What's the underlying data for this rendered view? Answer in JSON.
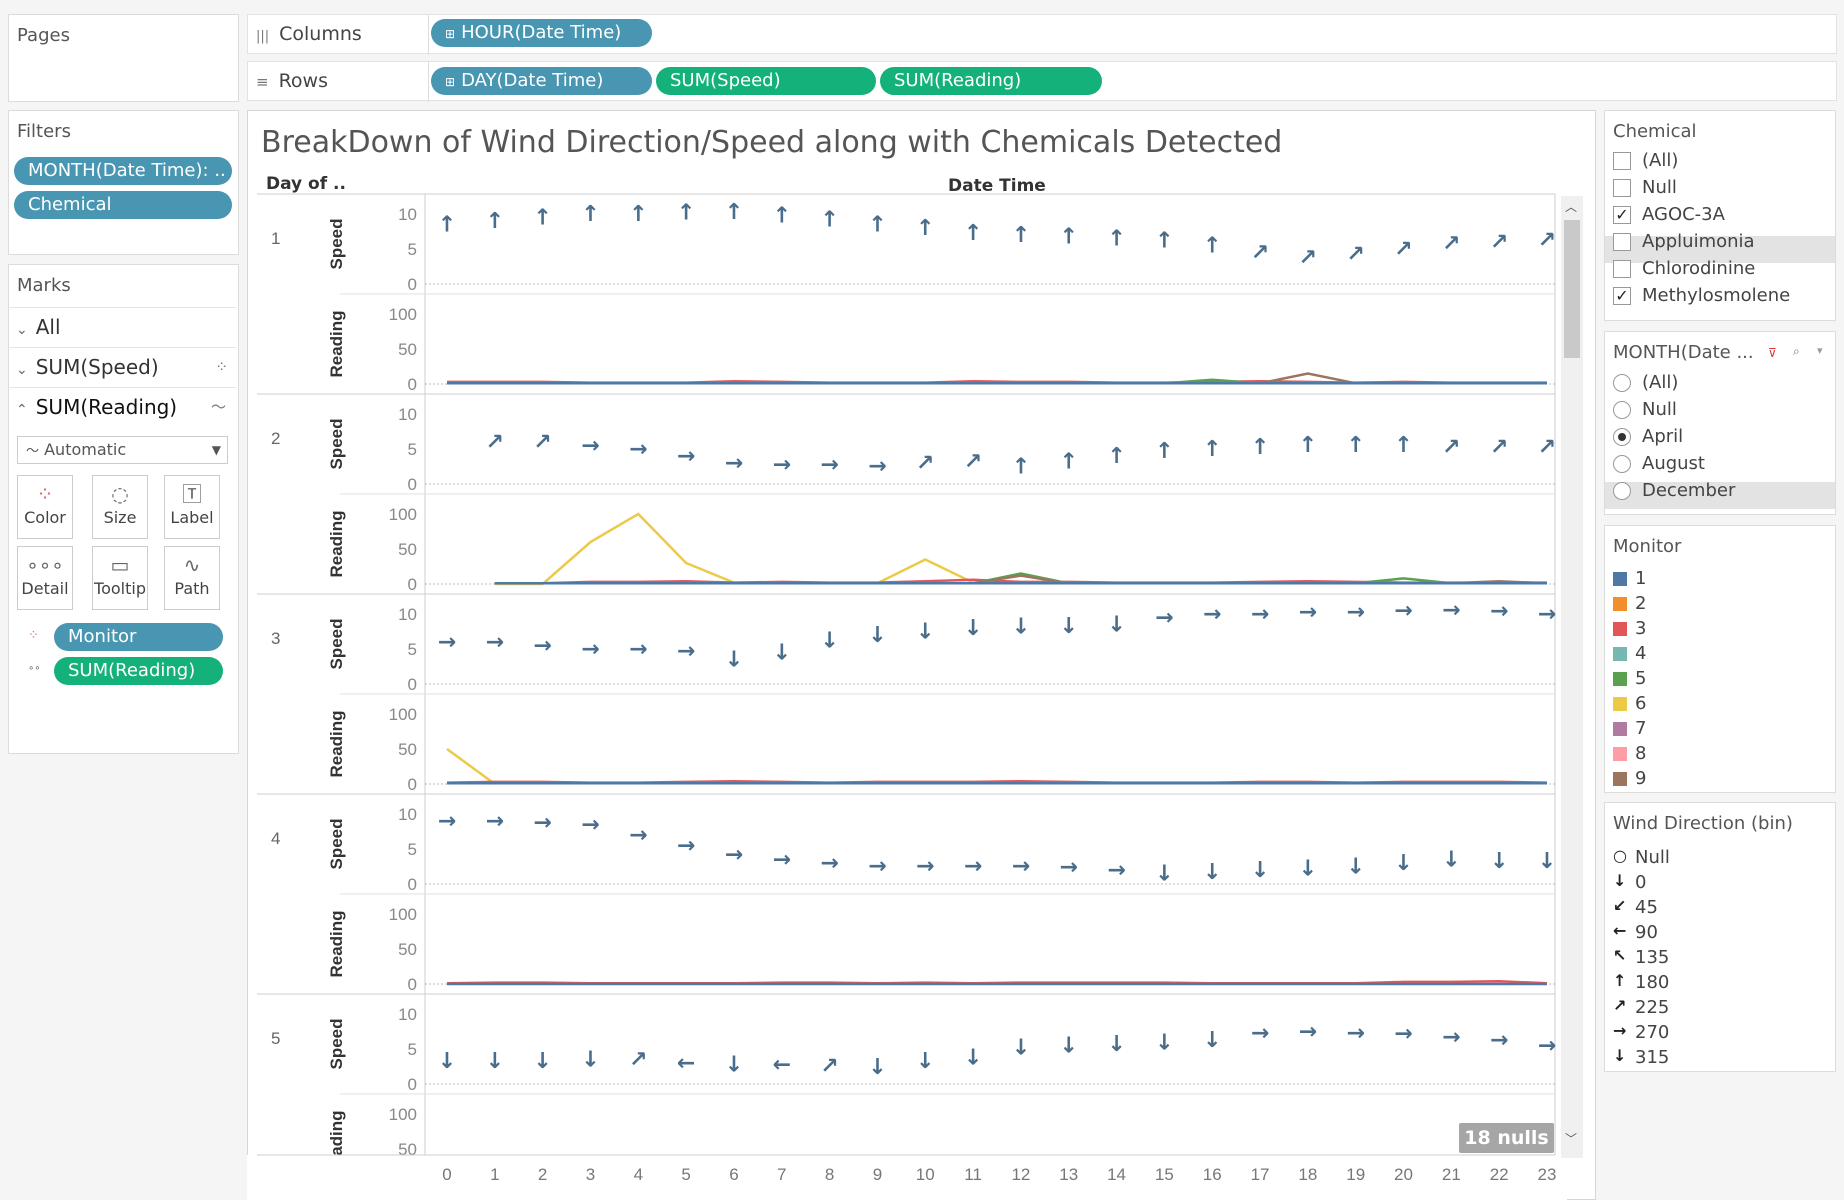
{
  "shelves": {
    "pages_label": "Pages",
    "columns_label": "Columns",
    "rows_label": "Rows",
    "columns_pills": [
      "HOUR(Date Time)"
    ],
    "rows_pills": [
      "DAY(Date Time)",
      "SUM(Speed)",
      "SUM(Reading)"
    ]
  },
  "filters": {
    "title": "Filters",
    "pills": [
      "MONTH(Date Time): ..",
      "Chemical"
    ]
  },
  "marks": {
    "title": "Marks",
    "all": "All",
    "sum_speed": "SUM(Speed)",
    "sum_reading": "SUM(Reading)",
    "mark_type": "Automatic",
    "buttons": [
      "Color",
      "Size",
      "Label",
      "Detail",
      "Tooltip",
      "Path"
    ],
    "fields": [
      "Monitor",
      "SUM(Reading)"
    ]
  },
  "view": {
    "title": "BreakDown of Wind Direction/Speed along with Chemicals Detected",
    "row_header": "Day of ..",
    "col_header": "Date Time",
    "speed_label": "Speed",
    "reading_label": "Reading",
    "nulls_badge": "18 nulls"
  },
  "chemical_filter": {
    "title": "Chemical",
    "options": [
      "(All)",
      "Null",
      "AGOC-3A",
      "Appluimonia",
      "Chlorodinine",
      "Methylosmolene"
    ],
    "checked": [
      false,
      false,
      true,
      false,
      false,
      true
    ]
  },
  "month_filter": {
    "title": "MONTH(Date ...",
    "options": [
      "(All)",
      "Null",
      "April",
      "August",
      "December"
    ],
    "selected": "April"
  },
  "monitor_legend": {
    "title": "Monitor",
    "items": [
      "1",
      "2",
      "3",
      "4",
      "5",
      "6",
      "7",
      "8",
      "9"
    ],
    "colors": [
      "#4e79a7",
      "#f28e2b",
      "#e15759",
      "#76b7b2",
      "#59a14f",
      "#edc948",
      "#b07aa1",
      "#ff9da7",
      "#9c755f"
    ]
  },
  "wind_legend": {
    "title": "Wind Direction (bin)",
    "items": [
      "Null",
      "0",
      "45",
      "90",
      "135",
      "180",
      "225",
      "270",
      "315"
    ],
    "glyphs": [
      "○",
      "↓",
      "↙",
      "←",
      "↖",
      "↑",
      "↗",
      "→",
      "↓"
    ]
  },
  "chart_data": {
    "type": "line",
    "title": "BreakDown of Wind Direction/Speed along with Chemicals Detected",
    "xlabel": "Date Time",
    "x": [
      0,
      1,
      2,
      3,
      4,
      5,
      6,
      7,
      8,
      9,
      10,
      11,
      12,
      13,
      14,
      15,
      16,
      17,
      18,
      19,
      20,
      21,
      22,
      23
    ],
    "speed_ylim": [
      0,
      10
    ],
    "reading_ylim": [
      0,
      100
    ],
    "speed_ticks": [
      0,
      5,
      10
    ],
    "reading_ticks": [
      0,
      50,
      100
    ],
    "days": [
      {
        "day": "1",
        "speed": [
          8.5,
          9,
          9.5,
          10,
          10,
          10.2,
          10.3,
          9.8,
          9.2,
          8.5,
          8,
          7.3,
          7,
          6.8,
          6.5,
          6.2,
          5.5,
          4.5,
          3.8,
          4.3,
          5,
          5.8,
          6,
          6.3
        ],
        "direction": [
          180,
          180,
          180,
          180,
          180,
          180,
          180,
          180,
          180,
          180,
          180,
          180,
          180,
          180,
          180,
          180,
          180,
          225,
          225,
          225,
          225,
          225,
          225,
          225
        ],
        "readings": [
          {
            "monitor": "3",
            "values": [
              3,
              3,
              3,
              2,
              2,
              2,
              4,
              3,
              2,
              2,
              2,
              4,
              3,
              3,
              2,
              2,
              3,
              4,
              3,
              2,
              3,
              2,
              2,
              2
            ]
          },
          {
            "monitor": "5",
            "values": [
              1,
              1,
              1,
              1,
              1,
              1,
              1,
              1,
              1,
              1,
              1,
              1,
              1,
              1,
              1,
              1,
              6,
              1,
              1,
              1,
              1,
              1,
              1,
              1
            ]
          },
          {
            "monitor": "9",
            "values": [
              1,
              1,
              1,
              1,
              1,
              1,
              1,
              1,
              1,
              1,
              1,
              1,
              1,
              1,
              1,
              1,
              1,
              1,
              15,
              1,
              1,
              1,
              1,
              1
            ]
          },
          {
            "monitor": "1",
            "values": [
              1,
              1,
              1,
              1,
              1,
              1,
              1,
              1,
              1,
              1,
              1,
              1,
              1,
              1,
              1,
              1,
              1,
              1,
              1,
              1,
              1,
              1,
              1,
              1
            ]
          }
        ]
      },
      {
        "day": "2",
        "speed": [
          null,
          6,
          6,
          5.5,
          5,
          4,
          3,
          2.8,
          2.8,
          2.6,
          3,
          3.2,
          2.5,
          3.2,
          4,
          4.7,
          5,
          5.3,
          5.6,
          5.6,
          5.6,
          5.3,
          5.3,
          5.3
        ],
        "direction": [
          null,
          225,
          225,
          270,
          270,
          270,
          270,
          270,
          270,
          270,
          225,
          225,
          180,
          180,
          180,
          180,
          180,
          180,
          180,
          180,
          180,
          225,
          225,
          225
        ],
        "readings": [
          {
            "monitor": "6",
            "values": [
              null,
              0,
              0,
              60,
              100,
              30,
              2,
              2,
              1,
              1,
              35,
              2,
              2,
              2,
              1,
              1,
              1,
              1,
              1,
              1,
              1,
              1,
              1,
              1
            ]
          },
          {
            "monitor": "3",
            "values": [
              null,
              1,
              1,
              3,
              3,
              4,
              2,
              3,
              2,
              2,
              4,
              6,
              3,
              3,
              2,
              2,
              2,
              3,
              4,
              3,
              2,
              2,
              2,
              2
            ]
          },
          {
            "monitor": "5",
            "values": [
              null,
              1,
              1,
              1,
              1,
              1,
              1,
              1,
              1,
              1,
              1,
              1,
              15,
              1,
              1,
              1,
              1,
              1,
              1,
              1,
              8,
              1,
              1,
              1
            ]
          },
          {
            "monitor": "9",
            "values": [
              null,
              1,
              1,
              1,
              1,
              1,
              1,
              1,
              1,
              1,
              1,
              1,
              12,
              1,
              1,
              1,
              1,
              1,
              1,
              1,
              1,
              1,
              4,
              1
            ]
          },
          {
            "monitor": "1",
            "values": [
              null,
              1,
              1,
              1,
              1,
              1,
              1,
              1,
              1,
              1,
              1,
              1,
              1,
              1,
              1,
              1,
              1,
              1,
              1,
              1,
              1,
              1,
              1,
              1
            ]
          }
        ]
      },
      {
        "day": "3",
        "speed": [
          6,
          6,
          5.5,
          5,
          5,
          4.7,
          3.5,
          4.5,
          6.2,
          7,
          7.5,
          8,
          8.2,
          8.3,
          8.5,
          9.5,
          10,
          10,
          10.3,
          10.3,
          10.5,
          10.6,
          10.4,
          10
        ],
        "direction": [
          270,
          270,
          270,
          270,
          270,
          270,
          0,
          0,
          0,
          0,
          0,
          0,
          0,
          0,
          0,
          270,
          270,
          270,
          270,
          270,
          270,
          270,
          270,
          270
        ],
        "readings": [
          {
            "monitor": "6",
            "values": [
              50,
              0,
              null,
              null,
              null,
              null,
              null,
              null,
              null,
              null,
              null,
              null,
              null,
              null,
              null,
              null,
              null,
              null,
              null,
              null,
              null,
              null,
              null,
              null
            ]
          },
          {
            "monitor": "3",
            "values": [
              2,
              3,
              3,
              2,
              2,
              3,
              4,
              3,
              2,
              3,
              3,
              3,
              4,
              3,
              2,
              2,
              2,
              3,
              3,
              2,
              3,
              3,
              3,
              2
            ]
          },
          {
            "monitor": "1",
            "values": [
              1,
              1,
              1,
              1,
              1,
              1,
              1,
              1,
              1,
              1,
              1,
              1,
              1,
              1,
              1,
              1,
              1,
              1,
              1,
              1,
              1,
              1,
              1,
              1
            ]
          }
        ]
      },
      {
        "day": "4",
        "speed": [
          9,
          9,
          8.8,
          8.5,
          7,
          5.5,
          4.2,
          3.5,
          3,
          2.6,
          2.6,
          2.6,
          2.6,
          2.4,
          2,
          1.5,
          1.7,
          2,
          2.2,
          2.5,
          3,
          3.5,
          3.3,
          3.3
        ],
        "direction": [
          270,
          270,
          270,
          270,
          270,
          270,
          270,
          270,
          270,
          270,
          270,
          270,
          270,
          270,
          270,
          0,
          0,
          0,
          0,
          0,
          0,
          0,
          0,
          0
        ],
        "readings": [
          {
            "monitor": "3",
            "values": [
              1,
              2,
              2,
              1,
              1,
              1,
              1,
              2,
              2,
              1,
              2,
              1,
              2,
              2,
              2,
              2,
              1,
              1,
              1,
              1,
              3,
              3,
              4,
              1
            ]
          },
          {
            "monitor": "1",
            "values": [
              0,
              0,
              0,
              0,
              0,
              0,
              0,
              0,
              0,
              0,
              0,
              0,
              0,
              0,
              0,
              0,
              0,
              0,
              0,
              0,
              0,
              0,
              0,
              0
            ]
          }
        ]
      },
      {
        "day": "5",
        "speed": [
          3.3,
          3.3,
          3.3,
          3.5,
          3.5,
          3,
          2.8,
          2.8,
          2.6,
          2.4,
          3.3,
          3.8,
          5.2,
          5.5,
          5.7,
          5.9,
          6.3,
          7.3,
          7.5,
          7.3,
          7.2,
          6.7,
          6.3,
          5.5
        ],
        "direction": [
          0,
          0,
          0,
          0,
          225,
          90,
          0,
          90,
          225,
          0,
          0,
          0,
          0,
          0,
          0,
          0,
          0,
          270,
          270,
          270,
          270,
          270,
          270,
          270
        ],
        "readings": []
      }
    ]
  }
}
